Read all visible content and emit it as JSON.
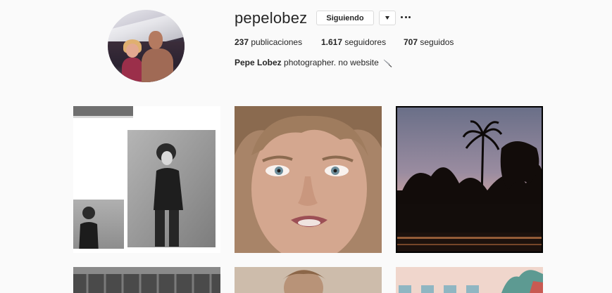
{
  "profile": {
    "username": "pepelobez",
    "follow_label": "Siguiendo",
    "dropdown_icon": "caret-down-icon",
    "more_icon": "ellipsis-icon",
    "avatar_icon": "profile-avatar"
  },
  "stats": {
    "posts_count": "237",
    "posts_label": "publicaciones",
    "followers_count": "1.617",
    "followers_label": "seguidores",
    "following_count": "707",
    "following_label": "seguidos"
  },
  "bio": {
    "name": "Pepe Lobez",
    "text": "photographer. no website",
    "emoji_icon": "knife-icon"
  },
  "posts": [
    {
      "name": "post-1",
      "description_icon": "photo-collage"
    },
    {
      "name": "post-2",
      "description_icon": "photo-portrait"
    },
    {
      "name": "post-3",
      "description_icon": "photo-sunset-palms"
    },
    {
      "name": "post-4",
      "description_icon": "photo"
    },
    {
      "name": "post-5",
      "description_icon": "photo"
    },
    {
      "name": "post-6",
      "description_icon": "photo"
    }
  ]
}
